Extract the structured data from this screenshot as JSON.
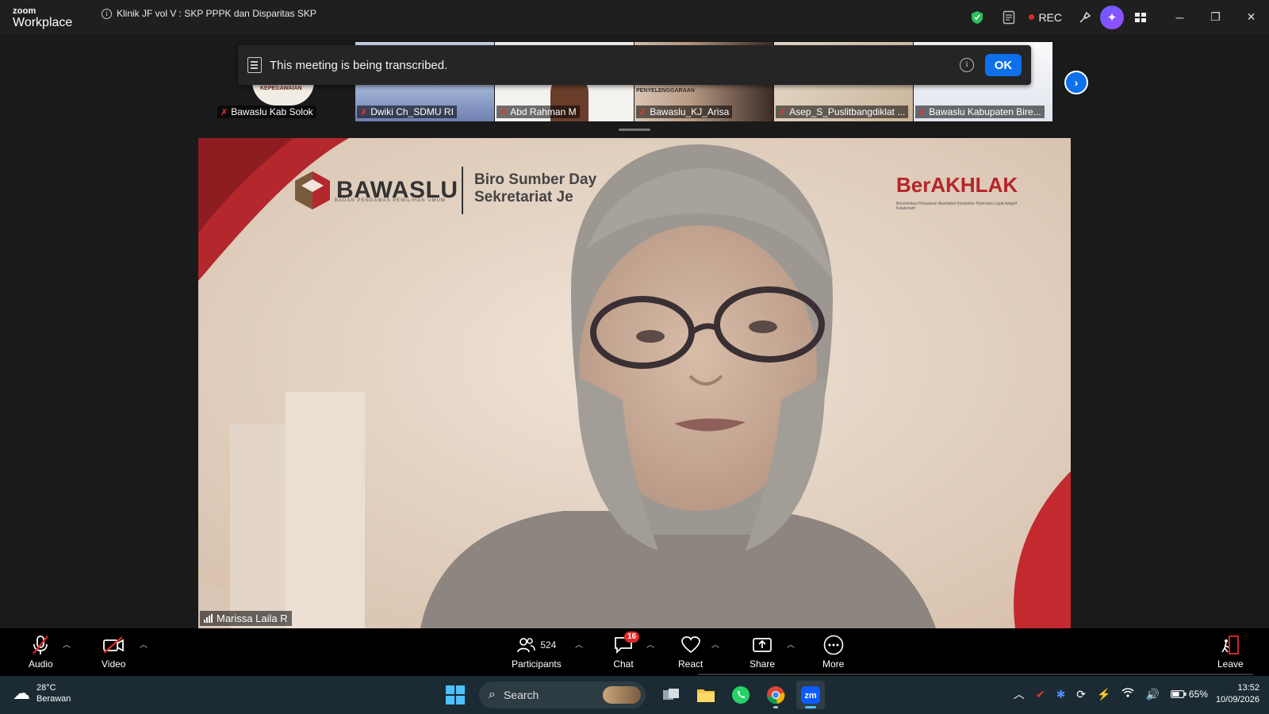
{
  "app": {
    "brand_small": "zoom",
    "brand_large": "Workplace"
  },
  "meeting": {
    "title": "Klinik JF vol V : SKP PPPK dan Disparitas SKP",
    "rec_label": "REC"
  },
  "banner": {
    "text": "This meeting is being transcribed.",
    "ok_label": "OK"
  },
  "gallery": [
    {
      "name": "Bawaslu Kab Solok",
      "muted": true
    },
    {
      "name": "Dwiki Ch_SDMU RI",
      "muted": true
    },
    {
      "name": "Abd Rahman M",
      "muted": true
    },
    {
      "name": "Bawaslu_KJ_Arisa",
      "muted": true
    },
    {
      "name": "Asep_S_Puslitbangdiklat ...",
      "muted": true
    },
    {
      "name": "Bawaslu Kabupaten Bire...",
      "muted": true
    }
  ],
  "tile_snippets": {
    "kepegawaian": "KEPEGAWAIAN",
    "penyelenggaraan": "PENYELENGGARAAN"
  },
  "speaker": {
    "name": "Marissa Laila R",
    "slide_brand": "BAWASLU",
    "slide_brand_sub": "BADAN PENGAWAS PEMILIHAN UMUM",
    "slide_biro_line1": "Biro Sumber Day",
    "slide_biro_line2": "Sekretariat Je",
    "slide_berakhlak": "BerAKHLAK",
    "slide_berakhlak_sub": "Berorientasi Pelayanan Akuntabel Kompeten Harmonis Loyal Adaptif Kolaboratif"
  },
  "toolbar": {
    "audio_label": "Audio",
    "video_label": "Video",
    "participants_label": "Participants",
    "participants_count": "524",
    "chat_label": "Chat",
    "chat_badge": "16",
    "react_label": "React",
    "share_label": "Share",
    "more_label": "More",
    "leave_label": "Leave"
  },
  "taskbar": {
    "weather_temp": "28°C",
    "weather_desc": "Berawan",
    "search_label": "Search",
    "battery": "65%",
    "time": "13:52",
    "date": "10/09/2026"
  },
  "colors": {
    "accent_blue": "#0e71eb",
    "rec_red": "#e02828",
    "bawaslu_red": "#b5252a"
  },
  "icons": [
    "shield-icon",
    "notes-icon",
    "brush-icon",
    "ai-companion-icon",
    "apps-icon",
    "minimize-icon",
    "restore-icon",
    "close-icon"
  ]
}
